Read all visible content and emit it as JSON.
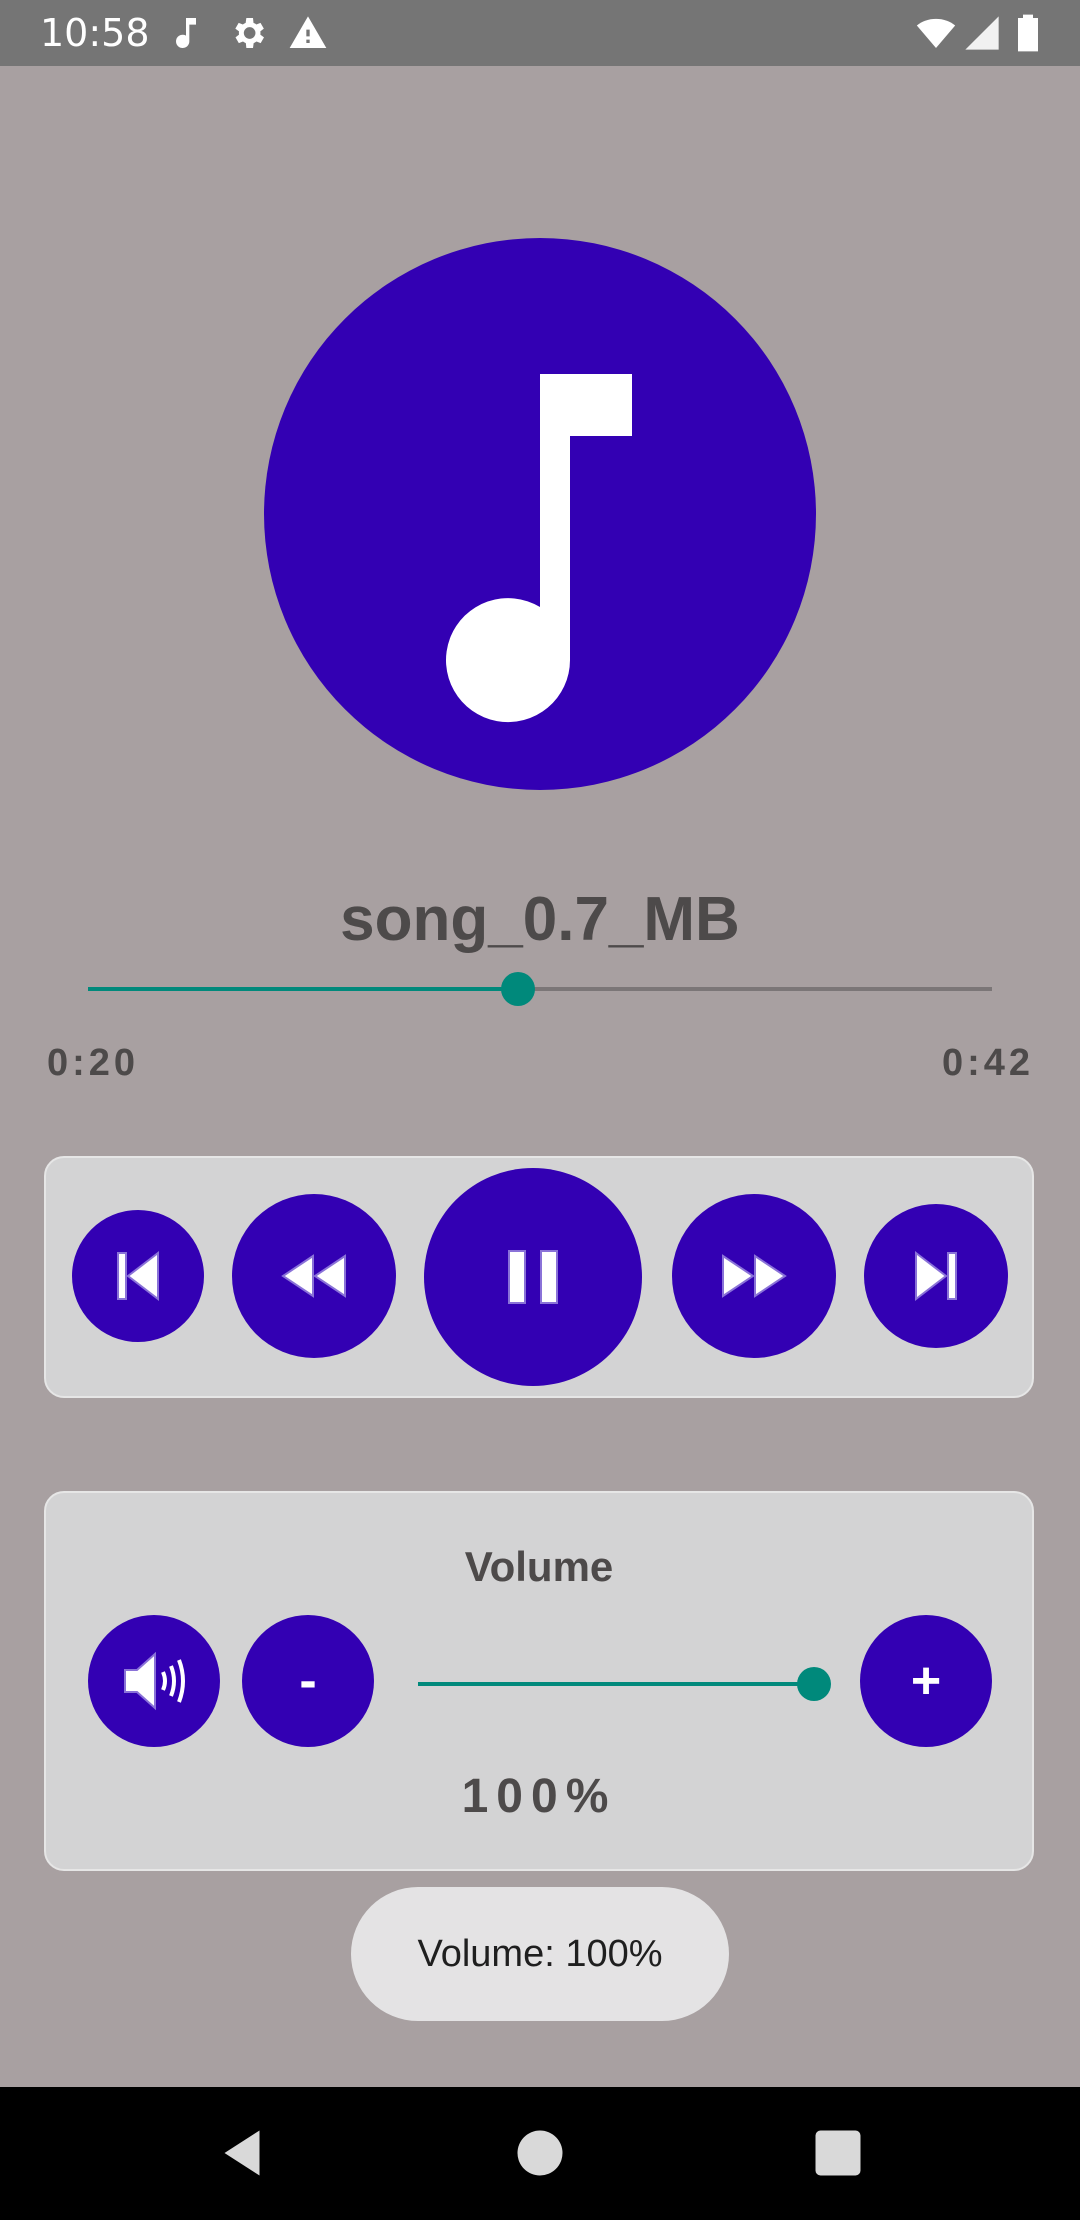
{
  "status_bar": {
    "time": "10:58",
    "left_icons": [
      "music-note-icon",
      "gear-icon",
      "warning-icon"
    ],
    "right_icons": [
      "wifi-icon",
      "cell-signal-icon",
      "battery-icon"
    ]
  },
  "player": {
    "album_art_icon": "music-note-icon",
    "song_title": "song_0.7_MB",
    "elapsed": "0:20",
    "duration": "0:42",
    "progress_fraction": 0.476,
    "accent_color": "#00897b",
    "button_color": "#3300b3"
  },
  "controls": {
    "buttons": [
      "skip-previous-icon",
      "rewind-icon",
      "pause-icon",
      "fast-forward-icon",
      "skip-next-icon"
    ]
  },
  "volume": {
    "heading": "Volume",
    "mute_icon": "speaker-icon",
    "decrease_label": "-",
    "increase_label": "+",
    "percent_text": "100%",
    "level_fraction": 1.0
  },
  "toast": {
    "text": "Volume: 100%"
  },
  "nav_bar": {
    "buttons": [
      "back-icon",
      "home-icon",
      "recents-icon"
    ]
  }
}
